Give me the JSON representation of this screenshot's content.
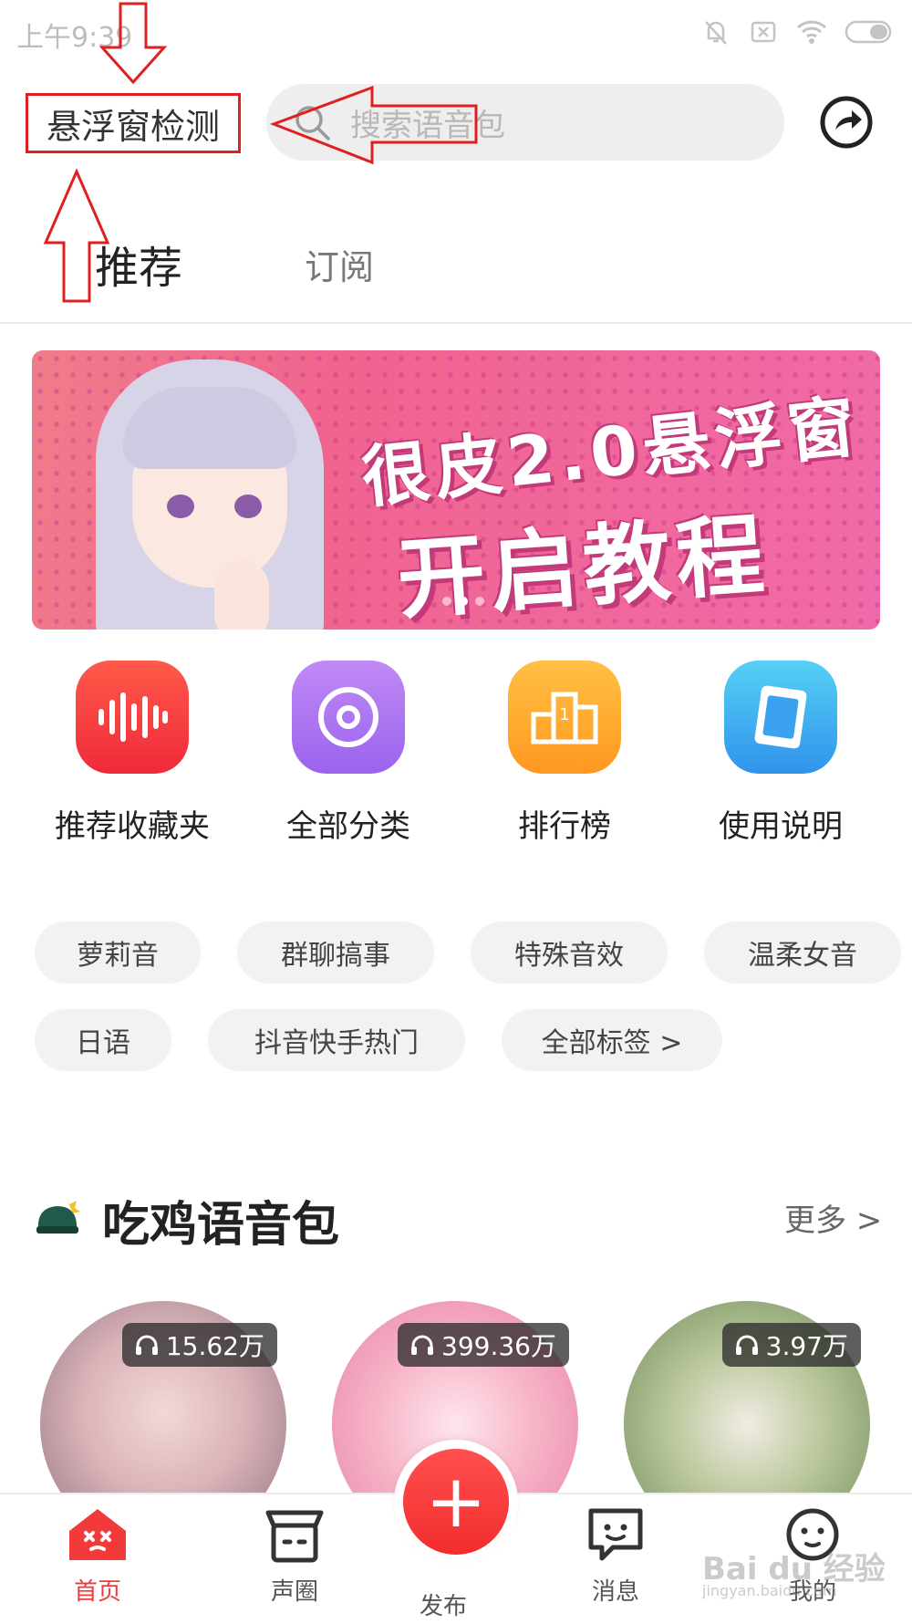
{
  "status_bar": {
    "time": "上午9:39"
  },
  "header": {
    "title": "悬浮窗检测",
    "search_placeholder": "搜索语音包"
  },
  "tabs": [
    {
      "label": "推荐",
      "active": true
    },
    {
      "label": "订阅",
      "active": false
    }
  ],
  "banner": {
    "line1": "很皮2.0悬浮窗",
    "line2": "开启教程",
    "page_count": 3,
    "active_page": 2
  },
  "quick_entries": [
    {
      "label": "推荐收藏夹",
      "icon": "waveform-icon",
      "color": "#f53a3a"
    },
    {
      "label": "全部分类",
      "icon": "disc-icon",
      "color": "#a66bf0"
    },
    {
      "label": "排行榜",
      "icon": "podium-icon",
      "color": "#ffa028"
    },
    {
      "label": "使用说明",
      "icon": "guide-book-icon",
      "color": "#39a7f0"
    }
  ],
  "tags_row1": [
    "萝莉音",
    "群聊搞事",
    "特殊音效",
    "温柔女音"
  ],
  "tags_row2": [
    "日语",
    "抖音快手热门",
    "全部标签 >"
  ],
  "section": {
    "title": "吃鸡语音包",
    "more": "更多 >",
    "icon": "helmet-icon"
  },
  "cards": [
    {
      "count": "15.62万"
    },
    {
      "count": "399.36万"
    },
    {
      "count": "3.97万"
    }
  ],
  "bottom_nav": {
    "home": "首页",
    "circle": "声圈",
    "publish": "发布",
    "messages": "消息",
    "mine": "我的",
    "active_color": "#f23a3a"
  },
  "watermark": {
    "brand": "Bai du 经验",
    "url": "jingyan.baidu.com"
  }
}
